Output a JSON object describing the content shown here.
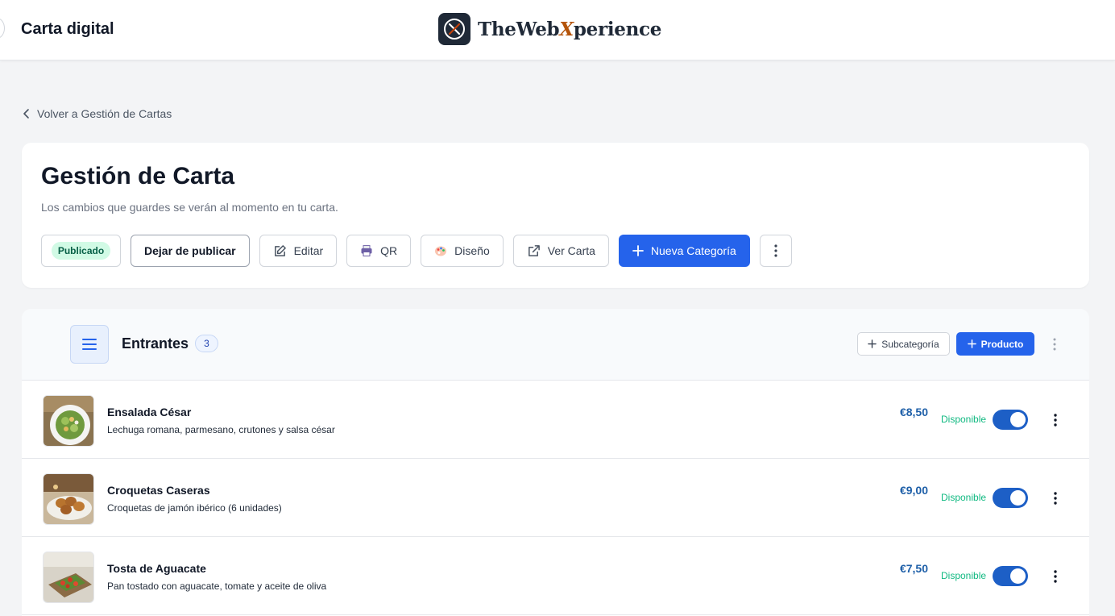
{
  "topbar": {
    "title": "Carta digital",
    "brand": {
      "prefix": "TheWeb",
      "accent": "X",
      "suffix": "perience"
    }
  },
  "back_link": "Volver a Gestión de Cartas",
  "header": {
    "title": "Gestión de Carta",
    "subtitle": "Los cambios que guardes se verán al momento en tu carta.",
    "status_badge": "Publicado",
    "unpublish_label": "Dejar de publicar",
    "edit_label": "Editar",
    "qr_label": "QR",
    "design_label": "Diseño",
    "view_label": "Ver Carta",
    "new_category_label": "Nueva Categoría"
  },
  "category": {
    "name": "Entrantes",
    "count": "3",
    "subcategory_label": "Subcategoría",
    "product_label": "Producto",
    "products": [
      {
        "name": "Ensalada César",
        "description": "Lechuga romana, parmesano, crutones y salsa césar",
        "price": "€8,50",
        "status": "Disponible",
        "enabled": true
      },
      {
        "name": "Croquetas Caseras",
        "description": "Croquetas de jamón ibérico (6 unidades)",
        "price": "€9,00",
        "status": "Disponible",
        "enabled": true
      },
      {
        "name": "Tosta de Aguacate",
        "description": "Pan tostado con aguacate, tomate y aceite de oliva",
        "price": "€7,50",
        "status": "Disponible",
        "enabled": true
      }
    ]
  },
  "colors": {
    "primary": "#2563eb",
    "price": "#1e5fa8",
    "available": "#10b981",
    "toggle_on": "#1d5fc6",
    "badge_bg": "#d1fae5"
  },
  "icons": {
    "brand": "crossed-utensils-icon",
    "back": "chevron-left-icon",
    "edit": "edit-icon",
    "qr": "printer-icon",
    "design": "palette-icon",
    "view": "external-link-icon",
    "add": "plus-icon",
    "more": "kebab-menu-icon",
    "drag": "drag-handle-icon"
  }
}
